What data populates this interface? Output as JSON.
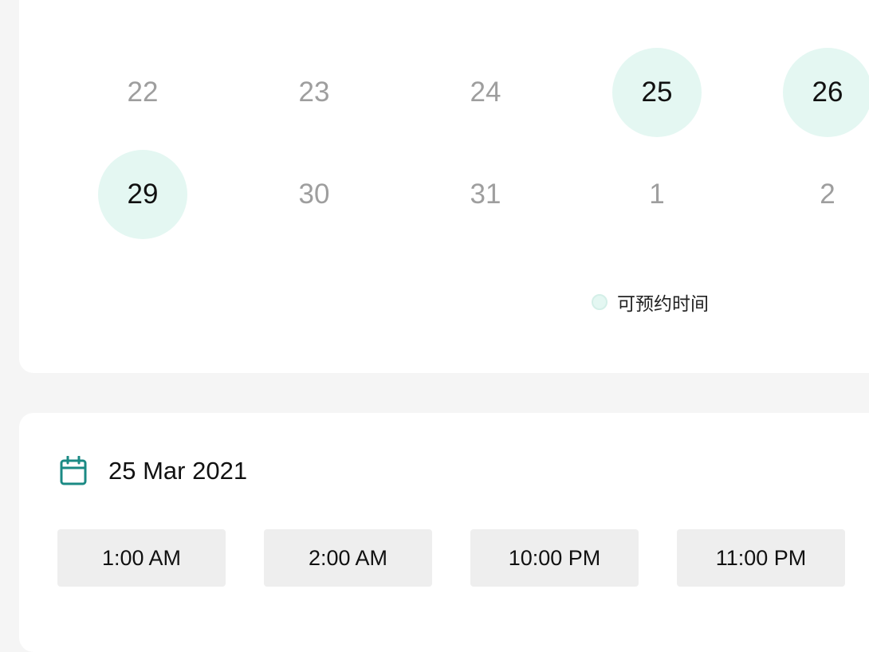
{
  "calendar": {
    "week_rows": [
      {
        "days": [
          {
            "label": "22",
            "available": false
          },
          {
            "label": "23",
            "available": false
          },
          {
            "label": "24",
            "available": false
          },
          {
            "label": "25",
            "available": true
          },
          {
            "label": "26",
            "available": true
          }
        ]
      },
      {
        "days": [
          {
            "label": "29",
            "available": true
          },
          {
            "label": "30",
            "available": false
          },
          {
            "label": "31",
            "available": false
          },
          {
            "label": "1",
            "available": false
          },
          {
            "label": "2",
            "available": false
          }
        ]
      }
    ],
    "legend_label": "可预约时间",
    "available_color": "#e4f7f2"
  },
  "schedule": {
    "selected_date": "25 Mar 2021",
    "time_slots": [
      "1:00 AM",
      "2:00 AM",
      "10:00 PM",
      "11:00 PM"
    ],
    "accent_color": "#1b8a84"
  }
}
